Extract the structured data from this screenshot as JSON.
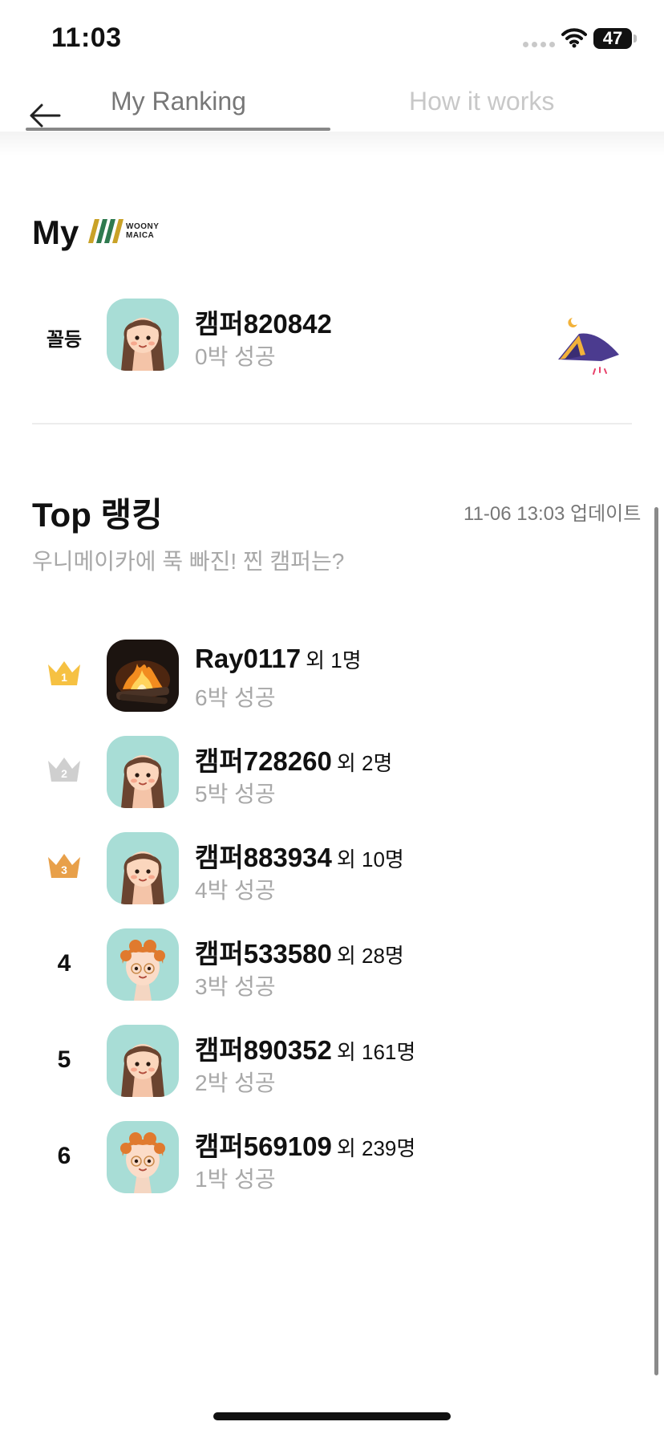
{
  "status_bar": {
    "time": "11:03",
    "battery": "47"
  },
  "tabs": [
    {
      "label": "My Ranking",
      "active": true
    },
    {
      "label": "How it works",
      "active": false
    }
  ],
  "my_section": {
    "title": "My",
    "logo_text_line1": "WOONY",
    "logo_text_line2": "MAICA",
    "entry": {
      "rank": "꼴등",
      "name": "캠퍼820842",
      "result": "0박 성공"
    }
  },
  "top_section": {
    "title": "Top 랭킹",
    "updated": "11-06 13:03 업데이트",
    "subtitle": "우니메이카에 푹 빠진! 찐 캠퍼는?",
    "rows": [
      {
        "rank": "1",
        "name": "Ray0117",
        "extra": "외 1명",
        "result": "6박 성공",
        "avatar": "campfire-photo"
      },
      {
        "rank": "2",
        "name": "캠퍼728260",
        "extra": "외 2명",
        "result": "5박 성공",
        "avatar": "girl-avatar"
      },
      {
        "rank": "3",
        "name": "캠퍼883934",
        "extra": "외 10명",
        "result": "4박 성공",
        "avatar": "girl-avatar"
      },
      {
        "rank": "4",
        "name": "캠퍼533580",
        "extra": "외 28명",
        "result": "3박 성공",
        "avatar": "boy-avatar"
      },
      {
        "rank": "5",
        "name": "캠퍼890352",
        "extra": "외 161명",
        "result": "2박 성공",
        "avatar": "girl-avatar"
      },
      {
        "rank": "6",
        "name": "캠퍼569109",
        "extra": "외 239명",
        "result": "1박 성공",
        "avatar": "boy-avatar"
      }
    ]
  },
  "colors": {
    "crown_gold": "#f6c142",
    "crown_silver": "#cfcfcf",
    "crown_bronze": "#e8a04a",
    "avatar_bg": "#a8ddd6",
    "tent_purple": "#4b3b8f",
    "tent_door": "#f2b23a"
  }
}
